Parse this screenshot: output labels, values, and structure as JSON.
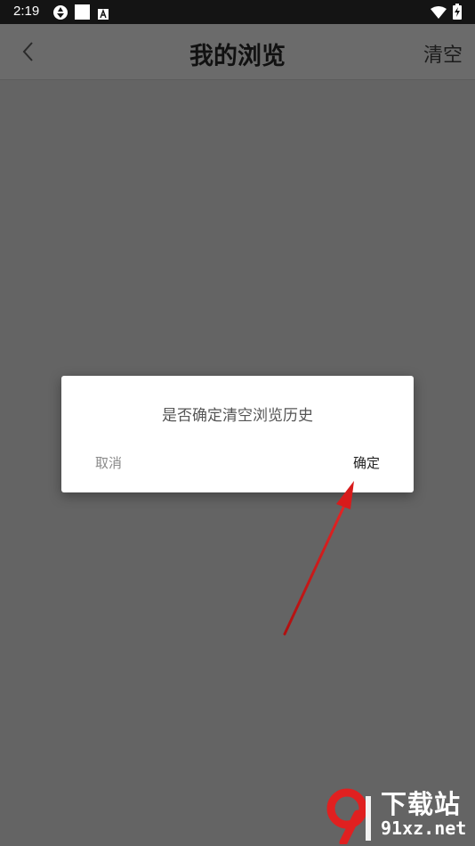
{
  "status_bar": {
    "time": "2:19",
    "icons": [
      "aperture-icon",
      "square-notification-icon",
      "a-notification-icon",
      "wifi-icon",
      "battery-charging-icon"
    ]
  },
  "app_bar": {
    "back_icon": "chevron-left-icon",
    "title": "我的浏览",
    "action_label": "清空"
  },
  "dialog": {
    "message": "是否确定清空浏览历史",
    "cancel_label": "取消",
    "confirm_label": "确定"
  },
  "overlay": {
    "annotation": "red-arrow-pointing-to-confirm",
    "scrim_color": "#646464"
  },
  "watermark": {
    "logo_text": "下载站",
    "domain": "91xz.net"
  },
  "colors": {
    "annotation_red": "#d81b1b",
    "watermark_red": "#e02020"
  }
}
